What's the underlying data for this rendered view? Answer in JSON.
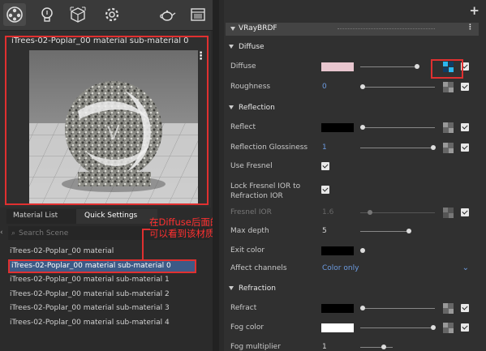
{
  "toolbar": {
    "buttons": [
      {
        "name": "material-icon"
      },
      {
        "name": "light-icon"
      },
      {
        "name": "geometry-icon"
      },
      {
        "name": "settings-icon"
      },
      {
        "name": "teapot-icon"
      },
      {
        "name": "render-window-icon"
      }
    ]
  },
  "preview": {
    "title": "iTrees-02-Poplar_00 material sub-material 0",
    "more_icon": "⋮"
  },
  "left_tabs": {
    "material_list": "Material List",
    "quick_settings": "Quick Settings"
  },
  "search": {
    "placeholder": "Search Scene"
  },
  "material_list": [
    "iTrees-02-Poplar_00 material",
    "iTrees-02-Poplar_00 material sub-material 0",
    "iTrees-02-Poplar_00 material sub-material 1",
    "iTrees-02-Poplar_00 material sub-material 2",
    "iTrees-02-Poplar_00 material sub-material 3",
    "iTrees-02-Poplar_00 material sub-material 4"
  ],
  "annotation": {
    "line1": "在Diffuse后面的棋盘格点亮后",
    "line2": "可以看到该材质的材质球已经发生了变化"
  },
  "right_panel": {
    "plus": "+",
    "brdf_title": "VRayBRDF",
    "brdf_more": "⋮",
    "sections": {
      "diffuse": "Diffuse",
      "reflection": "Reflection",
      "refraction": "Refraction"
    },
    "diffuse": {
      "diffuse_label": "Diffuse",
      "diffuse_color": "#e8c6cf",
      "roughness_label": "Roughness",
      "roughness_value": "0"
    },
    "reflection": {
      "reflect_label": "Reflect",
      "reflect_color": "#000000",
      "gloss_label": "Reflection Glossiness",
      "gloss_value": "1",
      "use_fresnel_label": "Use Fresnel",
      "lock_label_1": "Lock Fresnel IOR to",
      "lock_label_2": "Refraction IOR",
      "fresnel_ior_label": "Fresnel IOR",
      "fresnel_ior_value": "1.6",
      "max_depth_label": "Max depth",
      "max_depth_value": "5",
      "exit_color_label": "Exit color",
      "exit_color": "#000000",
      "affect_label": "Affect channels",
      "affect_value": "Color only"
    },
    "refraction": {
      "refract_label": "Refract",
      "refract_color": "#000000",
      "fog_color_label": "Fog color",
      "fog_color": "#ffffff",
      "fog_mult_label": "Fog multiplier",
      "fog_mult_value": "1"
    }
  },
  "colors": {
    "accent_blue": "#6c9be0",
    "highlight_red": "#e03030",
    "selection_blue": "#3d5a86"
  }
}
